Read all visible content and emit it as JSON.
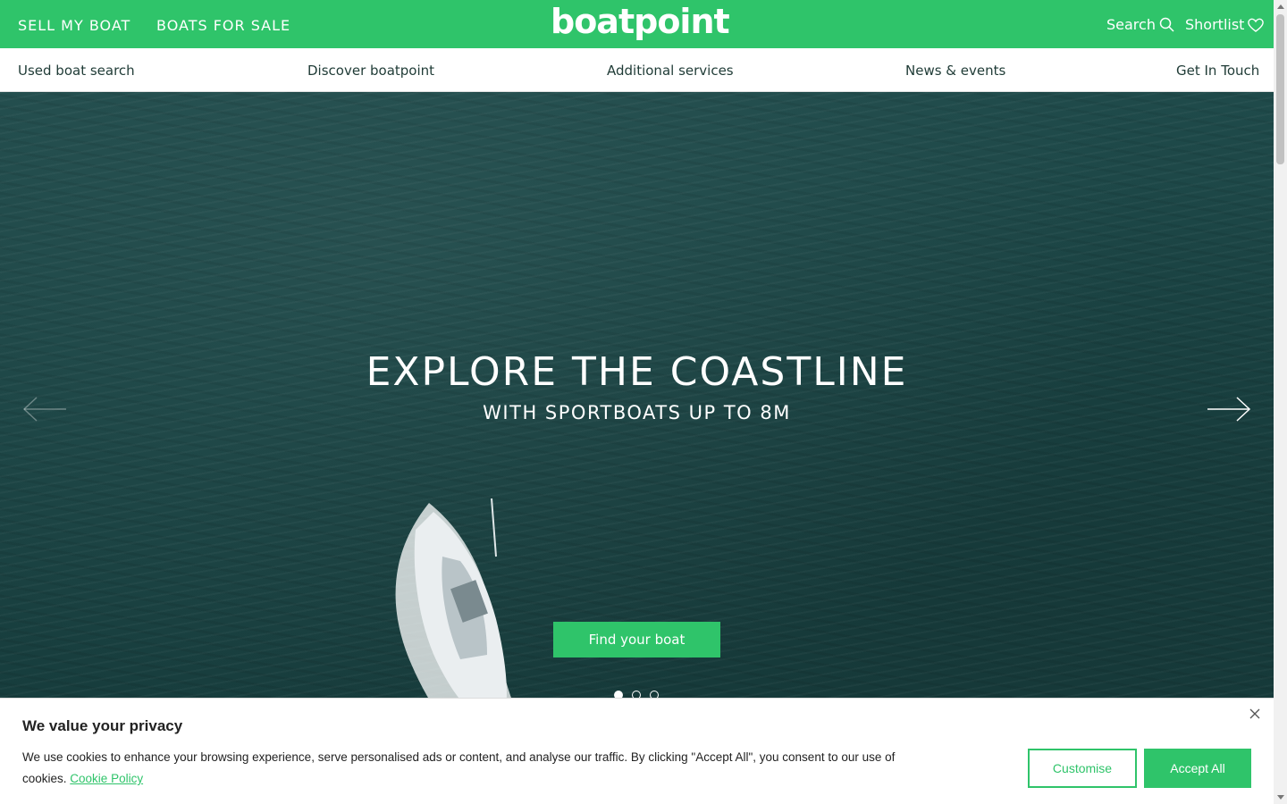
{
  "topbar": {
    "sell_label": "SELL MY BOAT",
    "boats_label": "BOATS FOR SALE",
    "logo_text": "boatpoint",
    "search_label": "Search",
    "shortlist_label": "Shortlist",
    "bg_color": "#2fc46a"
  },
  "subnav": {
    "items": [
      {
        "label": "Used boat search"
      },
      {
        "label": "Discover boatpoint"
      },
      {
        "label": "Additional services"
      },
      {
        "label": "News & events"
      },
      {
        "label": "Get In Touch"
      }
    ]
  },
  "hero": {
    "title": "EXPLORE THE COASTLINE",
    "subtitle": "WITH SPORTBOATS UP TO 8M",
    "cta_label": "Find your boat",
    "slides_total": 3,
    "active_slide": 1,
    "prev_icon": "arrow-left-icon",
    "next_icon": "arrow-right-icon"
  },
  "cookie": {
    "title": "We value your privacy",
    "text": "We use cookies to enhance your browsing experience, serve personalised ads or content, and analyse our traffic. By clicking \"Accept All\", you consent to our use of cookies.",
    "policy_label": "Cookie Policy",
    "customise_label": "Customise",
    "accept_label": "Accept All",
    "accent_color": "#2fc46a"
  }
}
